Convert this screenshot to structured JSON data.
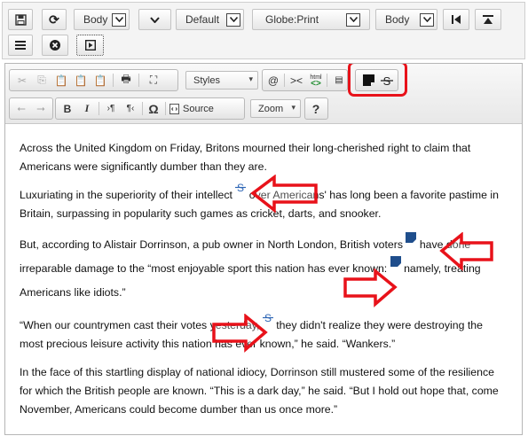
{
  "top_toolbar": {
    "row1": [
      {
        "name": "save-icon",
        "glyph": "🖫"
      },
      {
        "name": "refresh-icon",
        "glyph": "⟳"
      },
      {
        "name": "paragraph-style-select",
        "label": "Body"
      },
      {
        "name": "chevron-down-icon",
        "glyph": "⌄"
      },
      {
        "name": "template-select",
        "label": "Default"
      },
      {
        "name": "print-style-select",
        "label": "Globe:Print"
      },
      {
        "name": "body-select",
        "label": "Body"
      },
      {
        "name": "skip-back-icon",
        "glyph": "⏮"
      },
      {
        "name": "align-top-icon",
        "glyph": "⤒"
      }
    ],
    "row2": [
      {
        "name": "menu-icon",
        "glyph": "≡"
      },
      {
        "name": "close-circle-icon",
        "glyph": "✖"
      },
      {
        "name": "embed-icon",
        "glyph": "▣"
      }
    ]
  },
  "editor_toolbar": {
    "styles_label": "Styles",
    "source_label": "Source",
    "zoom_label": "Zoom",
    "html_label": "html",
    "help_label": "?",
    "bold_label": "B",
    "italic_label": "I",
    "omega_label": "Ω",
    "at_label": "@"
  },
  "content": {
    "p1": "Across the United Kingdom on Friday, Britons mourned their long-cherished right to claim that Americans were significantly dumber than they are.",
    "p2a": "Luxuriating in the superiority of their intellect ",
    "p2b": " over Americans' has long been a favorite pastime in Britain, surpassing in popularity such games as cricket, darts, and snooker.",
    "p3a": "But, according to Alistair Dorrinson, a pub owner in North London, British voters ",
    "p3b": " have done irreparable damage to the “most enjoyable sport this nation has ever known: ",
    "p3c": " namely, treating Americans like idiots.”",
    "p4a": "“When our countrymen cast their votes yesterday, ",
    "p4b": " they didn't realize they were destroying the most precious leisure activity this nation has ever known,” he said. “Wankers.”",
    "p5": "In the face of this startling display of national idiocy, Dorrinson still mustered some of the resilience for which the British people are known. “This is a dark day,” he said. “But I hold out hope that, come November, Americans could become dumber than us once more.”"
  },
  "colors": {
    "highlight": "#e8121a",
    "note_marker": "#1f4e8c",
    "strike_marker": "#2e66b5"
  }
}
